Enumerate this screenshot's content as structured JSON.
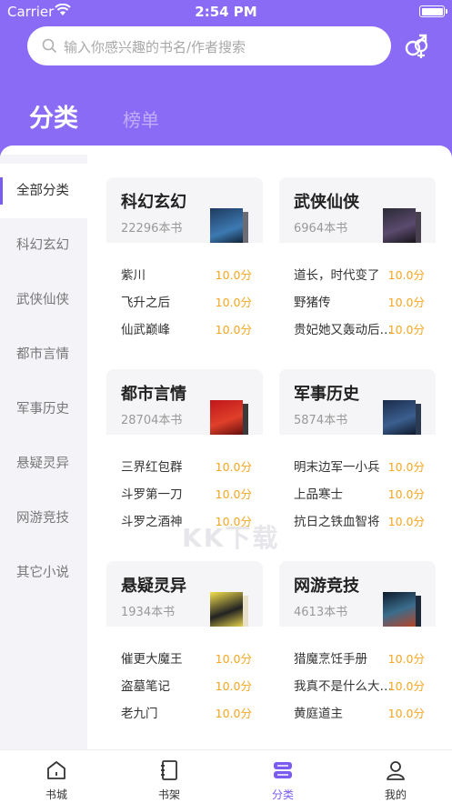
{
  "status_bar": {
    "carrier": "Carrier",
    "time": "2:54 PM"
  },
  "search": {
    "placeholder": "输入你感兴趣的书名/作者搜索"
  },
  "tabs": {
    "category": "分类",
    "ranking": "榜单"
  },
  "sidebar": {
    "items": [
      {
        "label": "全部分类",
        "active": true
      },
      {
        "label": "科幻玄幻"
      },
      {
        "label": "武侠仙侠"
      },
      {
        "label": "都市言情"
      },
      {
        "label": "军事历史"
      },
      {
        "label": "悬疑灵异"
      },
      {
        "label": "网游竞技"
      },
      {
        "label": "其它小说"
      }
    ]
  },
  "categories": [
    {
      "title": "科幻玄幻",
      "count": "22296本书",
      "books": [
        {
          "name": "紫川",
          "score": "10.0分"
        },
        {
          "name": "飞升之后",
          "score": "10.0分"
        },
        {
          "name": "仙武巅峰",
          "score": "10.0分"
        }
      ]
    },
    {
      "title": "武侠仙侠",
      "count": "6964本书",
      "books": [
        {
          "name": "道长，时代变了",
          "score": "10.0分"
        },
        {
          "name": "野猪传",
          "score": "10.0分"
        },
        {
          "name": "贵妃她又轰动后宫了",
          "score": "10.0分"
        }
      ]
    },
    {
      "title": "都市言情",
      "count": "28704本书",
      "books": [
        {
          "name": "三界红包群",
          "score": "10.0分"
        },
        {
          "name": "斗罗第一刀",
          "score": "10.0分"
        },
        {
          "name": "斗罗之酒神",
          "score": "10.0分"
        }
      ]
    },
    {
      "title": "军事历史",
      "count": "5874本书",
      "books": [
        {
          "name": "明末边军一小兵",
          "score": "10.0分"
        },
        {
          "name": "上品寒士",
          "score": "10.0分"
        },
        {
          "name": "抗日之铁血智将",
          "score": "10.0分"
        }
      ]
    },
    {
      "title": "悬疑灵异",
      "count": "1934本书",
      "books": [
        {
          "name": "催更大魔王",
          "score": "10.0分"
        },
        {
          "name": "盗墓笔记",
          "score": "10.0分"
        },
        {
          "name": "老九门",
          "score": "10.0分"
        }
      ]
    },
    {
      "title": "网游竞技",
      "count": "4613本书",
      "books": [
        {
          "name": "猎魔烹饪手册",
          "score": "10.0分"
        },
        {
          "name": "我真不是什么大魔王",
          "score": "10.0分"
        },
        {
          "name": "黄庭道主",
          "score": "10.0分"
        }
      ]
    }
  ],
  "bottom_nav": [
    {
      "label": "书城",
      "icon": "home-icon"
    },
    {
      "label": "书架",
      "icon": "bookshelf-icon"
    },
    {
      "label": "分类",
      "icon": "category-icon",
      "active": true
    },
    {
      "label": "我的",
      "icon": "profile-icon"
    }
  ],
  "watermark": "KK下载",
  "colors": {
    "header": "#8a6bf5",
    "accent": "#7b5cf0",
    "score": "#f5a623"
  }
}
